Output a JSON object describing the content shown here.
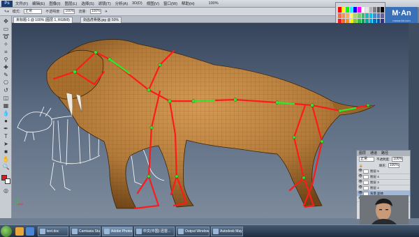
{
  "menubar": {
    "app_logo": "Ps",
    "items": [
      "文件(F)",
      "编辑(E)",
      "图像(I)",
      "图层(L)",
      "选择(S)",
      "滤镜(T)",
      "分析(A)",
      "3D(D)",
      "视图(V)",
      "窗口(W)",
      "帮助(H)"
    ],
    "zoom": "100%"
  },
  "tool_options": {
    "mode_label": "模式:",
    "mode_value": "正常",
    "opacity_label": "不透明度:",
    "opacity_value": "100%",
    "flow_label": "流量:",
    "flow_value": "100%"
  },
  "document_tabs": [
    {
      "label": "未标题-1 @ 100% (图层 1, RGB/8)",
      "active": true
    },
    {
      "label": "剑齿虎骨骼.jpg @ 50%",
      "active": false
    }
  ],
  "brand": {
    "text": "M·An",
    "subtext": "manan3d.com"
  },
  "swatches": {
    "colors": [
      "#ff0000",
      "#ffff00",
      "#00ff00",
      "#00ffff",
      "#0000ff",
      "#ff00ff",
      "#ffffff",
      "#e6e6e6",
      "#b3b3b3",
      "#808080",
      "#4d4d4d",
      "#000000",
      "#f26c4f",
      "#f68e56",
      "#fbaf5c",
      "#fff467",
      "#acd372",
      "#7cc576",
      "#3bb878",
      "#1abbb4",
      "#00bff3",
      "#438ccb",
      "#5574b9",
      "#605ca8",
      "#ed1c24",
      "#f26522",
      "#f7941d",
      "#fff200",
      "#8dc63f",
      "#39b54a",
      "#00a651",
      "#00a99d",
      "#00aeef",
      "#0072bc",
      "#0054a6",
      "#2e3192",
      "#9e0b0f",
      "#a0410d",
      "#a36209",
      "#aba000",
      "#598527",
      "#1a7b30",
      "#007236",
      "#00746b",
      "#0076a3",
      "#004b80",
      "#003471",
      "#1b1464"
    ]
  },
  "layers_panel": {
    "tabs": [
      "图层",
      "通道",
      "路径"
    ],
    "blend_mode": "正常",
    "opacity_label": "不透明度:",
    "opacity_value": "100%",
    "fill_label": "填充:",
    "fill_value": "100%",
    "layers": [
      {
        "name": "图层 5",
        "selected": false
      },
      {
        "name": "图层 4",
        "selected": false
      },
      {
        "name": "图层 3",
        "selected": false
      },
      {
        "name": "图层 2",
        "selected": false
      },
      {
        "name": "背景 副本",
        "selected": true
      },
      {
        "name": "背景",
        "selected": false
      }
    ]
  },
  "taskbar": {
    "tasks": [
      {
        "label": "text.doc",
        "active": false
      },
      {
        "label": "Camtasia Studio -...",
        "active": false
      },
      {
        "label": "Adobe Photosh...",
        "active": true
      },
      {
        "label": "中文(中国)-迅雷...",
        "active": false
      },
      {
        "label": "Output Window",
        "active": false
      },
      {
        "label": "Autodesk Maya ...",
        "active": false
      }
    ]
  },
  "colors": {
    "creature_skin": "#b27a3a",
    "joint_lines": "#ff1a1a",
    "joint_nodes": "#2ee62e",
    "viewport_bg": "#4c5b70"
  }
}
